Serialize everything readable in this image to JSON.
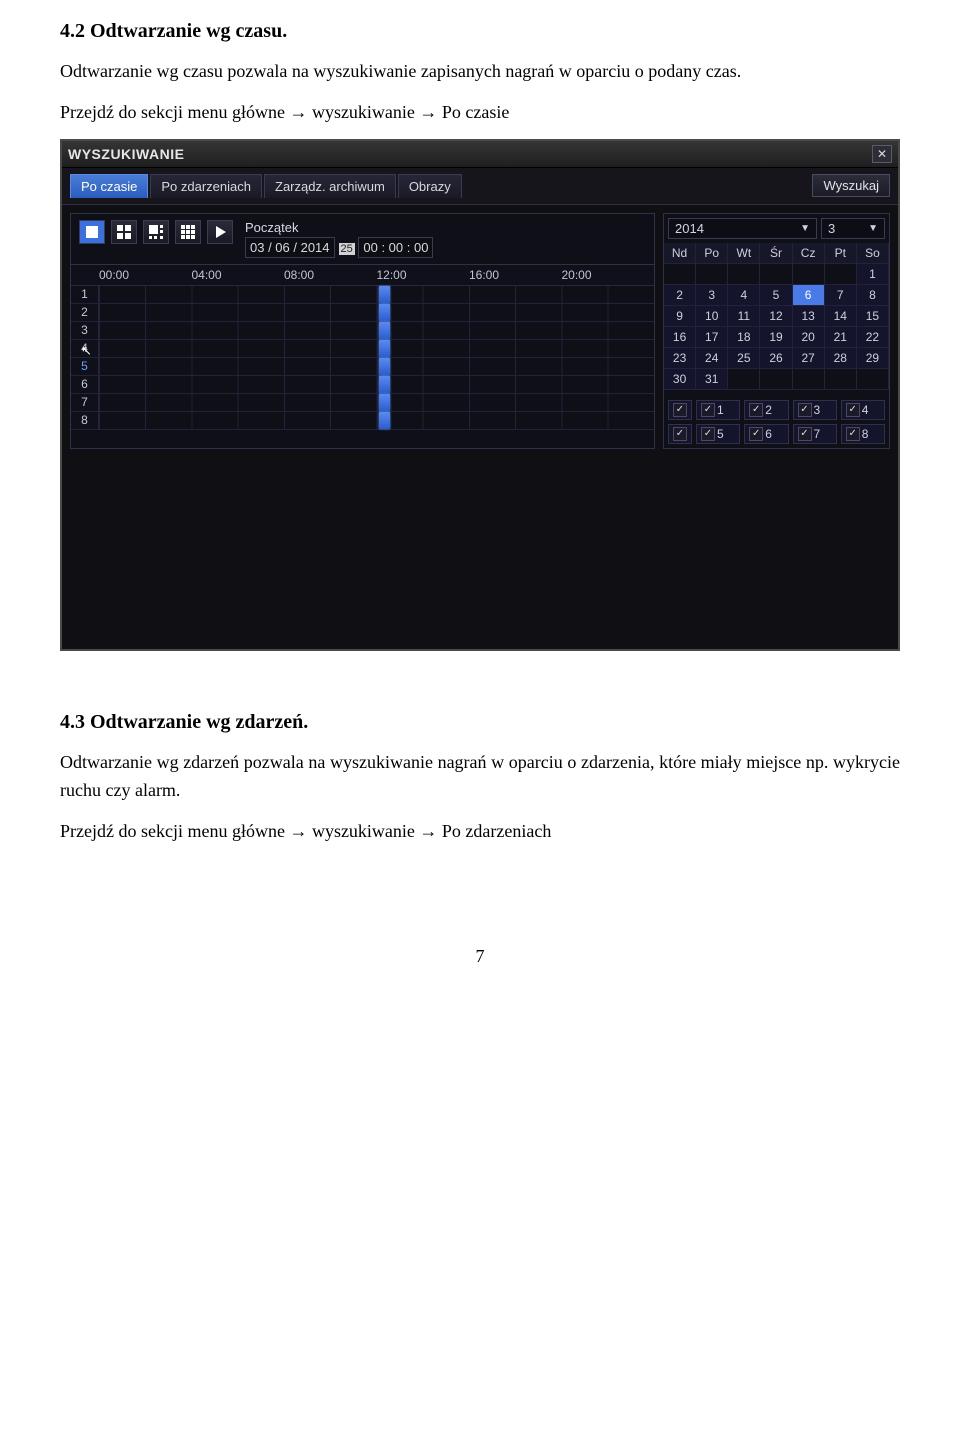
{
  "doc": {
    "h1": "4.2 Odtwarzanie wg czasu.",
    "p1": "Odtwarzanie wg czasu pozwala na wyszukiwanie zapisanych nagrań w oparciu o podany czas.",
    "p2": "Przejdź do sekcji menu główne → wyszukiwanie → Po czasie",
    "h2": "4.3 Odtwarzanie wg zdarzeń.",
    "p3": "Odtwarzanie wg zdarzeń pozwala na wyszukiwanie nagrań w oparciu o zdarzenia, które miały miejsce np. wykrycie ruchu czy alarm.",
    "p4": "Przejdź do sekcji menu główne → wyszukiwanie → Po zdarzeniach",
    "page_num": "7"
  },
  "window": {
    "title": "WYSZUKIWANIE",
    "tabs": {
      "t0": "Po czasie",
      "t1": "Po zdarzeniach",
      "t2": "Zarządz. archiwum",
      "t3": "Obrazy"
    },
    "search_btn": "Wyszukaj",
    "start_label": "Początek",
    "date_value": "03 / 06 / 2014",
    "date_extra": "25",
    "time_value": "00  :  00   :   00",
    "timeline_hours": {
      "h0": "00:00",
      "h1": "04:00",
      "h2": "08:00",
      "h3": "12:00",
      "h4": "16:00",
      "h5": "20:00"
    },
    "rows": {
      "r1": "1",
      "r2": "2",
      "r3": "3",
      "r4": "4",
      "r5": "5",
      "r6": "6",
      "r7": "7",
      "r8": "8"
    },
    "calendar": {
      "year": "2014",
      "month": "3",
      "dow": {
        "d0": "Nd",
        "d1": "Po",
        "d2": "Wt",
        "d3": "Śr",
        "d4": "Cz",
        "d5": "Pt",
        "d6": "So"
      },
      "cells": {
        "c0": "",
        "c1": "",
        "c2": "",
        "c3": "",
        "c4": "",
        "c5": "",
        "c6": "1",
        "c7": "2",
        "c8": "3",
        "c9": "4",
        "c10": "5",
        "c11": "6",
        "c12": "7",
        "c13": "8",
        "c14": "9",
        "c15": "10",
        "c16": "11",
        "c17": "12",
        "c18": "13",
        "c19": "14",
        "c20": "15",
        "c21": "16",
        "c22": "17",
        "c23": "18",
        "c24": "19",
        "c25": "20",
        "c26": "21",
        "c27": "22",
        "c28": "23",
        "c29": "24",
        "c30": "25",
        "c31": "26",
        "c32": "27",
        "c33": "28",
        "c34": "29",
        "c35": "30",
        "c36": "31",
        "c37": "",
        "c38": "",
        "c39": "",
        "c40": "",
        "c41": ""
      }
    },
    "channels": {
      "c1": "1",
      "c2": "2",
      "c3": "3",
      "c4": "4",
      "c5": "5",
      "c6": "6",
      "c7": "7",
      "c8": "8"
    }
  }
}
